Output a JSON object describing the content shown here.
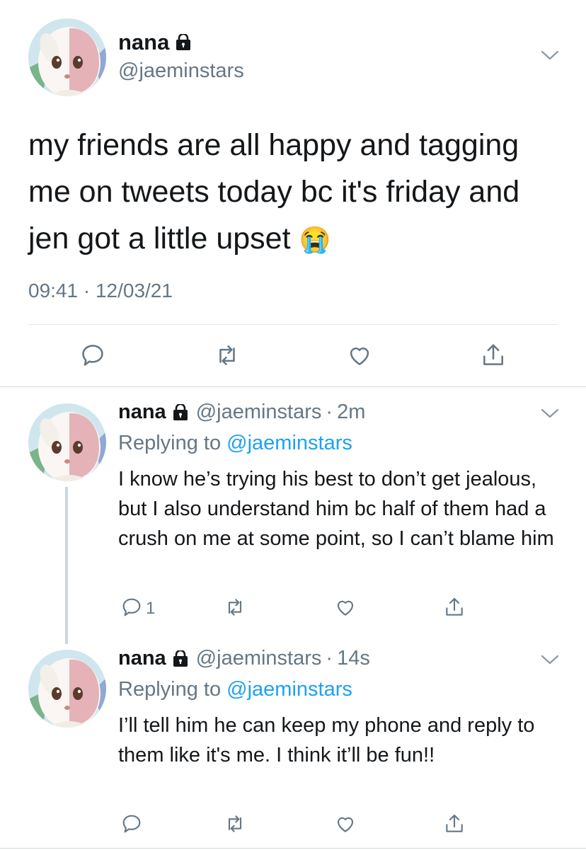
{
  "main_tweet": {
    "display_name": "nana",
    "handle": "@jaeminstars",
    "text": "my friends are all happy and tagging me on tweets today bc it's friday and jen got a little upset",
    "emoji": "😭",
    "timestamp": "09:41 · 12/03/21",
    "icons": [
      "lock-icon",
      "chevron-down-icon",
      "reply-icon",
      "retweet-icon",
      "like-icon",
      "share-icon"
    ]
  },
  "replies": [
    {
      "display_name": "nana",
      "handle": "@jaeminstars",
      "separator": "·",
      "time": "2m",
      "replying_prefix": "Replying to",
      "replying_to": "@jaeminstars",
      "text": "I know he’s trying his best to don’t get jealous, but I also understand him bc half of them had a crush on me at some point, so I can’t blame him",
      "reply_count": "1"
    },
    {
      "display_name": "nana",
      "handle": "@jaeminstars",
      "separator": "·",
      "time": "14s",
      "replying_prefix": "Replying to",
      "replying_to": "@jaeminstars",
      "text": "I’ll tell him he can keep my phone and reply to them like it's me. I think it’ll be fun!!",
      "reply_count": ""
    }
  ],
  "colors": {
    "text": "#14171a",
    "secondary": "#657786",
    "link": "#1da1f2",
    "divider": "#e1e8ed",
    "thread_line": "#ccd6dd"
  }
}
